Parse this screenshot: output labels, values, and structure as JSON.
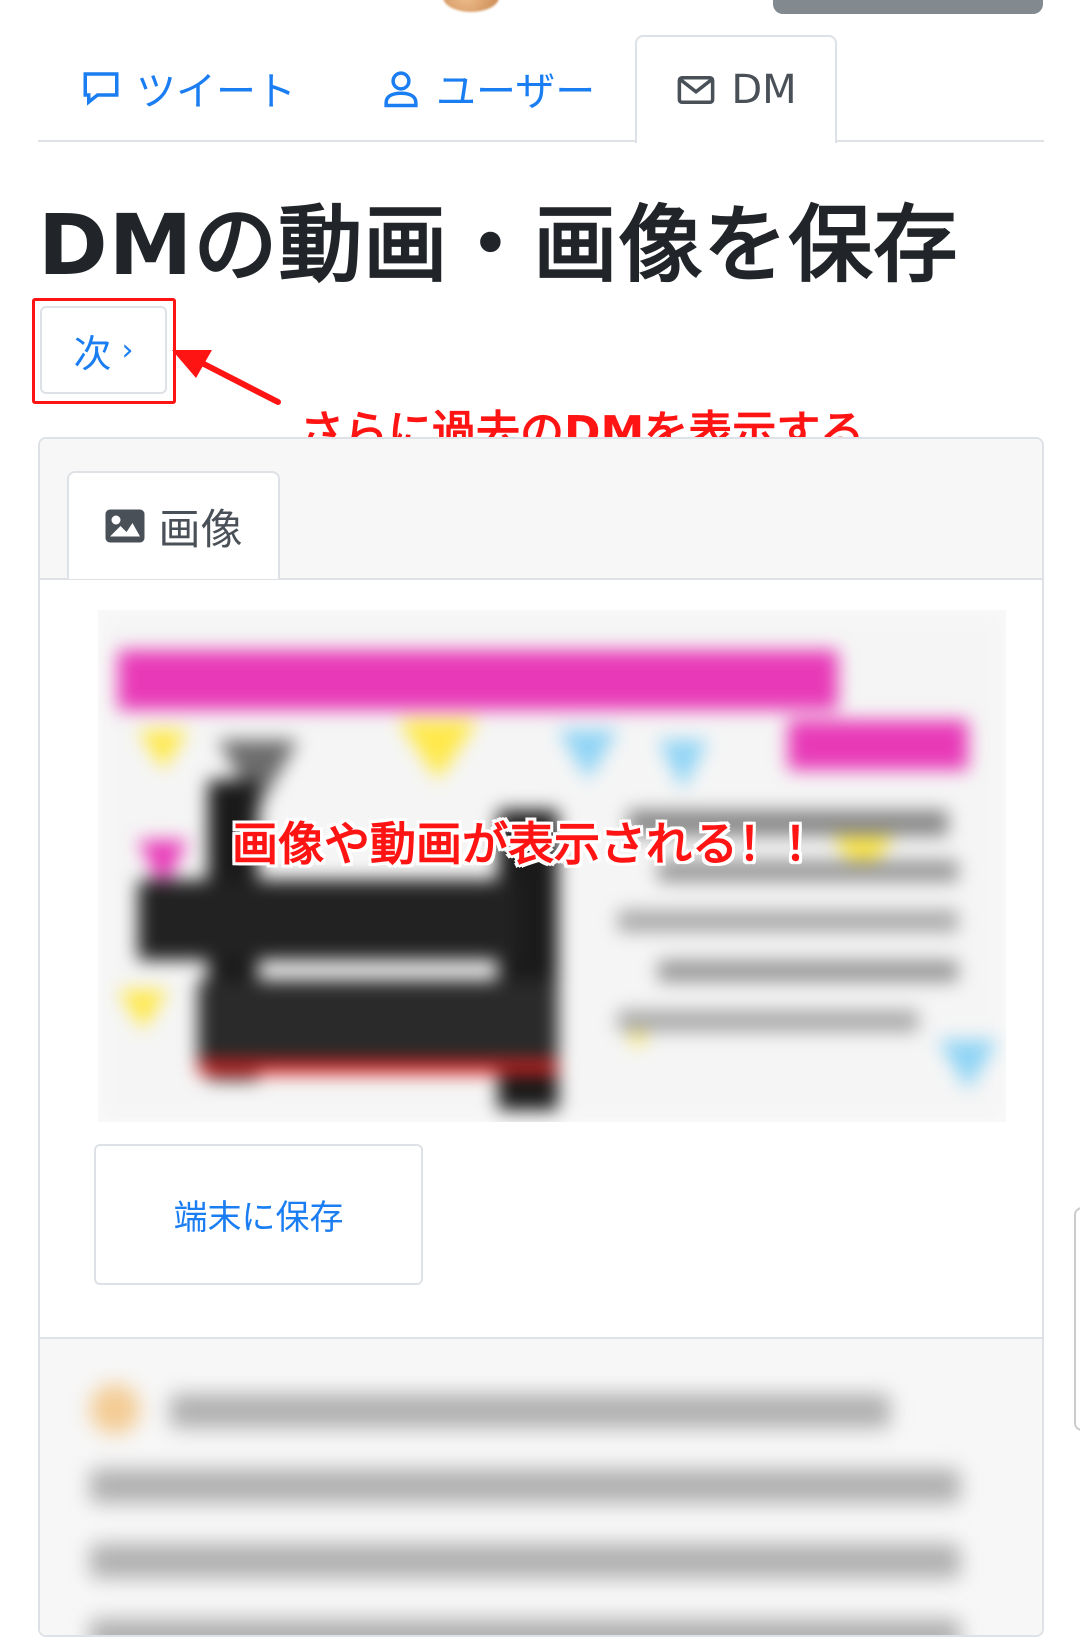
{
  "nav": {
    "tabs": [
      {
        "label": "ツイート",
        "icon": "chat-bubble-icon",
        "active": false
      },
      {
        "label": "ユーザー",
        "icon": "user-icon",
        "active": false
      },
      {
        "label": "DM",
        "icon": "envelope-icon",
        "active": true
      }
    ]
  },
  "page": {
    "title": "DMの動画・画像を保存",
    "next_label": "次",
    "next_chevron": "›"
  },
  "annotations": {
    "next_note": "さらに過去のDMを表示する",
    "media_note": "画像や動画が表示される！！"
  },
  "card": {
    "tab_label": "画像",
    "tab_icon": "image-icon",
    "save_label": "端末に保存"
  },
  "colors": {
    "link": "#1a7ef2",
    "annotation": "#ff1414",
    "border": "#dee2e6",
    "header_bg": "#f7f7f7"
  }
}
